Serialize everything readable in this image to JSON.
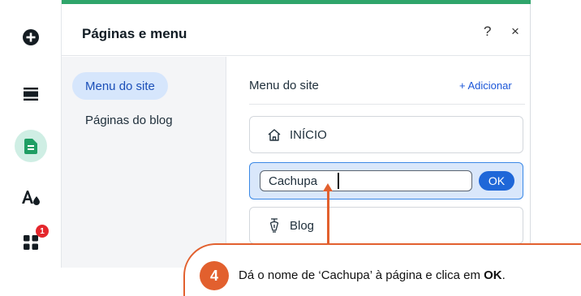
{
  "rail": {
    "items": [
      {
        "icon": "add-icon"
      },
      {
        "icon": "sections-icon"
      },
      {
        "icon": "pages-icon",
        "active": true
      },
      {
        "icon": "design-icon"
      },
      {
        "icon": "apps-icon",
        "badge": "1"
      }
    ]
  },
  "panel": {
    "title": "Páginas e menu",
    "help_label": "?",
    "close_label": "×"
  },
  "sidenav": {
    "items": [
      {
        "label": "Menu do site",
        "active": true
      },
      {
        "label": "Páginas do blog",
        "active": false
      }
    ]
  },
  "content": {
    "title": "Menu do site",
    "add_label": "+ Adicionar",
    "pages": [
      {
        "label": "INÍCIO",
        "icon": "home-icon"
      },
      {
        "label": "Blog",
        "icon": "pen-nib-icon"
      }
    ],
    "rename": {
      "value": "Cachupa",
      "ok_label": "OK"
    }
  },
  "callout": {
    "step": "4",
    "text_before": "Dá o nome de ‘Cachupa’ à página e clica em ",
    "text_bold": "OK",
    "text_after": "."
  },
  "colors": {
    "accent_green": "#2fa56b",
    "accent_blue": "#1f67d8",
    "callout_orange": "#e2602e",
    "badge_red": "#e4262c"
  }
}
